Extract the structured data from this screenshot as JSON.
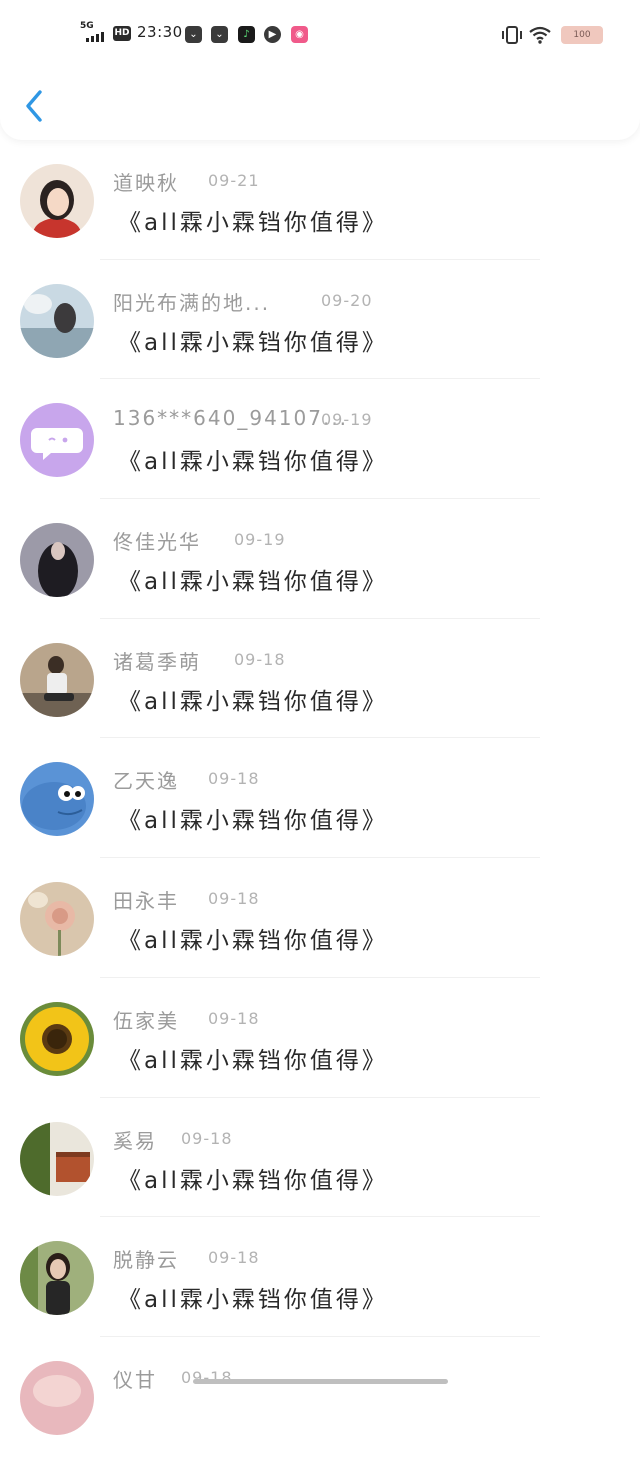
{
  "status_bar": {
    "network": "5G",
    "hd": "HD",
    "time": "23:30",
    "battery": "100",
    "app_icons": [
      "message-icon",
      "message-icon",
      "music-icon",
      "play-icon",
      "app-icon"
    ]
  },
  "colors": {
    "accent": "#2f97e4",
    "name": "#9b9b9b",
    "date": "#b3b3b3",
    "message": "#2a2a2a"
  },
  "messages": [
    {
      "name": "道映秋",
      "date": "09-21",
      "text": "《all霖小霖铛你值得》"
    },
    {
      "name": "阳光布满的地...",
      "date": "09-20",
      "text": "《all霖小霖铛你值得》"
    },
    {
      "name": "136***640_94107...",
      "date": "09-19",
      "text": "《all霖小霖铛你值得》"
    },
    {
      "name": "佟佳光华",
      "date": "09-19",
      "text": "《all霖小霖铛你值得》"
    },
    {
      "name": "诸葛季萌",
      "date": "09-18",
      "text": "《all霖小霖铛你值得》"
    },
    {
      "name": "乙天逸",
      "date": "09-18",
      "text": "《all霖小霖铛你值得》"
    },
    {
      "name": "田永丰",
      "date": "09-18",
      "text": "《all霖小霖铛你值得》"
    },
    {
      "name": "伍家美",
      "date": "09-18",
      "text": "《all霖小霖铛你值得》"
    },
    {
      "name": "奚易",
      "date": "09-18",
      "text": "《all霖小霖铛你值得》"
    },
    {
      "name": "脱静云",
      "date": "09-18",
      "text": "《all霖小霖铛你值得》"
    },
    {
      "name": "仪甘",
      "date": "09-18",
      "text": ""
    }
  ]
}
